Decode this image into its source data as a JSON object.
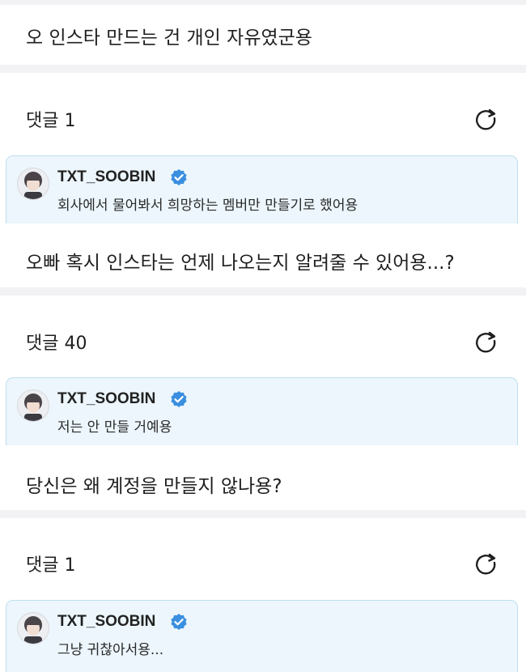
{
  "threads": [
    {
      "question": "오 인스타 만드는 건 개인 자유였군용",
      "comment_count_label": "댓글 1",
      "reply": {
        "author": "TXT_SOOBIN",
        "text": "회사에서 물어봐서 희망하는 멤버만 만들기로 했어용"
      }
    },
    {
      "question": "오빠 혹시 인스타는 언제 나오는지 알려줄 수 있어용...?",
      "comment_count_label": "댓글 40",
      "reply": {
        "author": "TXT_SOOBIN",
        "text": "저는 안 만들 거예용"
      }
    },
    {
      "question": "당신은 왜 계정을 만들지 않나용?",
      "comment_count_label": "댓글 1",
      "reply": {
        "author": "TXT_SOOBIN",
        "text": "그냥 귀찮아서용..."
      }
    }
  ],
  "icons": {
    "refresh": "refresh-icon",
    "verified": "verified-badge-icon"
  },
  "colors": {
    "verified_blue": "#3b8fe0",
    "reply_bg": "#ecf6fc",
    "reply_border": "#bfdfef",
    "separator": "#f2f2f4"
  }
}
